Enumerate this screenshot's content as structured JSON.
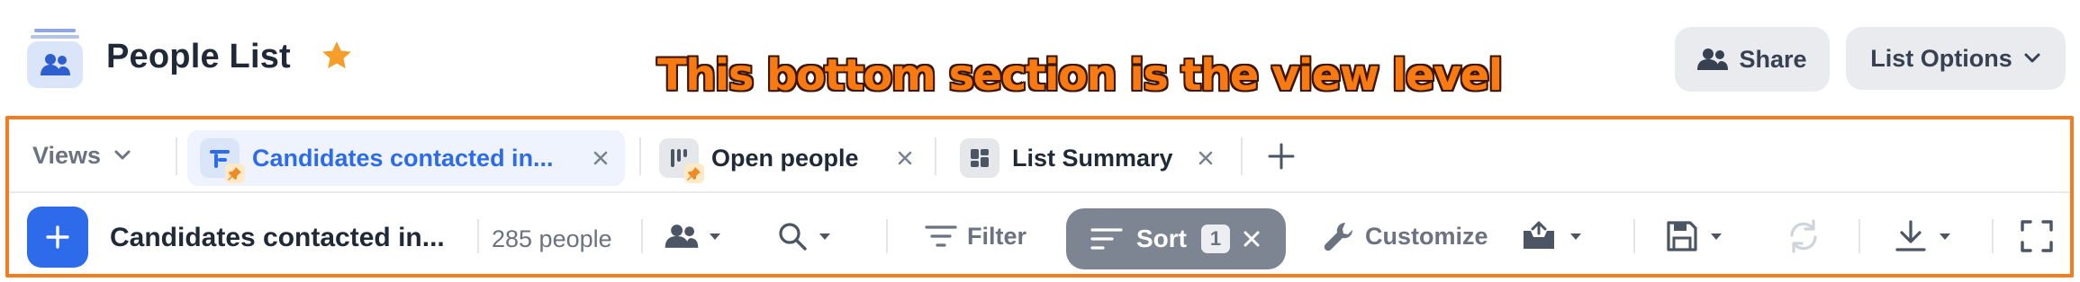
{
  "header": {
    "title": "People List",
    "share_label": "Share",
    "list_options_label": "List Options"
  },
  "annotation": "This bottom section is the view level",
  "views_label": "Views",
  "tabs": [
    {
      "label": "Candidates contacted in...",
      "active": true,
      "pinned": true,
      "icon": "timeline-icon"
    },
    {
      "label": "Open people",
      "active": false,
      "pinned": true,
      "icon": "board-icon"
    },
    {
      "label": "List Summary",
      "active": false,
      "pinned": false,
      "icon": "summary-grid-icon"
    }
  ],
  "toolbar": {
    "view_name": "Candidates contacted in...",
    "count": "285 people",
    "filter_label": "Filter",
    "sort_label": "Sort",
    "sort_count": "1",
    "customize_label": "Customize"
  },
  "colors": {
    "accent": "#2d6bea",
    "annotation": "#f97a10",
    "frame": "#f47c20",
    "star": "#f59e2a",
    "sort_pill": "#7d8593"
  }
}
